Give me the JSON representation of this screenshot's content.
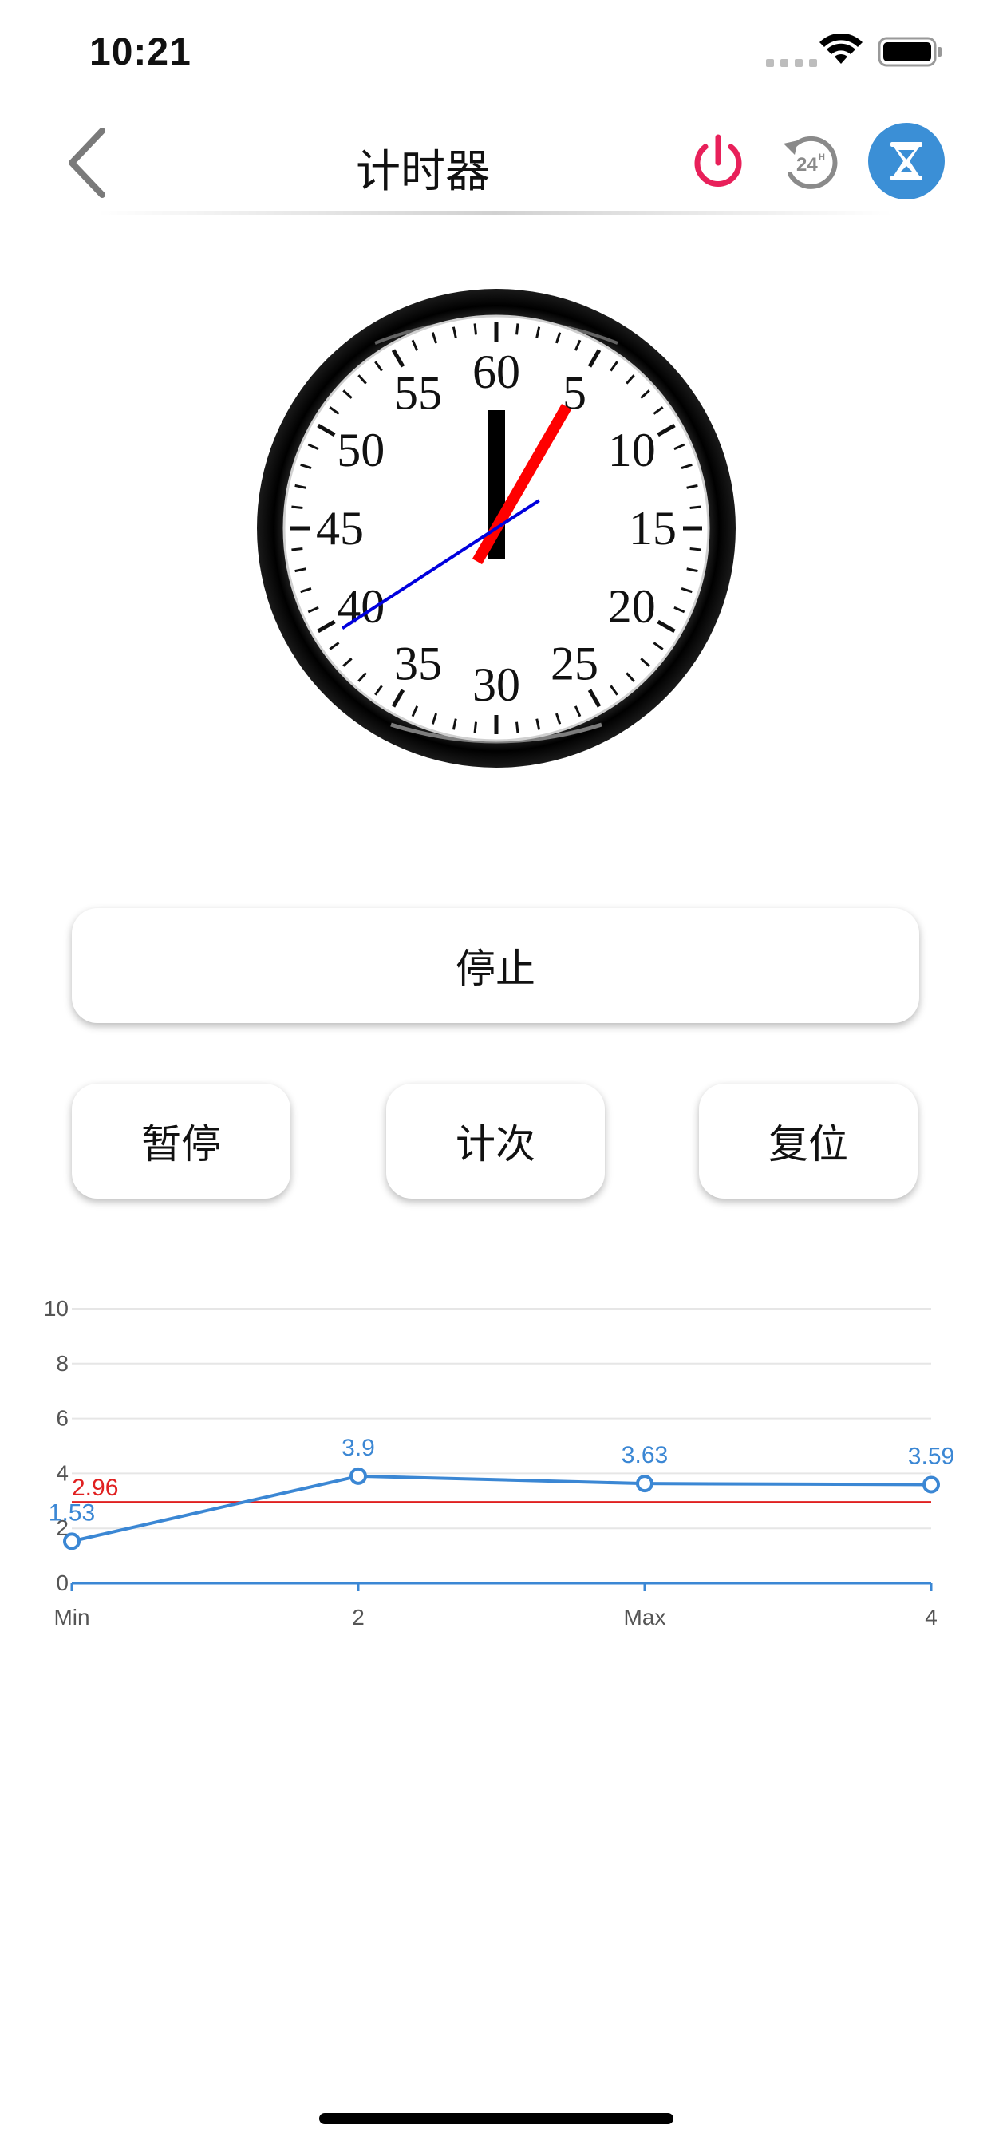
{
  "status_bar": {
    "time": "10:21"
  },
  "nav": {
    "title": "计时器"
  },
  "icons": {
    "back": "chevron-left-icon",
    "power": "power-icon",
    "clock24": "24h-history-icon",
    "timer": "hourglass-icon"
  },
  "colors": {
    "accent": "#3b8fd6",
    "power": "#e8205a",
    "line": "#3b87d4",
    "average": "#e02020"
  },
  "clock": {
    "dial_numbers": [
      "60",
      "5",
      "10",
      "15",
      "20",
      "25",
      "30",
      "35",
      "40",
      "45",
      "50",
      "55"
    ],
    "hands": {
      "minute_hand_value": 0,
      "red_hand_value": 5,
      "blue_hand_value": 9.5
    }
  },
  "buttons": {
    "stop": "停止",
    "pause": "暂停",
    "lap": "计次",
    "reset": "复位"
  },
  "chart_data": {
    "type": "line",
    "categories": [
      "Min",
      "2",
      "Max",
      "4"
    ],
    "values": [
      1.53,
      3.9,
      3.63,
      3.59
    ],
    "data_labels": [
      "1.53",
      "3.9",
      "3.63",
      "3.59"
    ],
    "y_ticks": [
      "0",
      "2",
      "4",
      "6",
      "8",
      "10"
    ],
    "ylim": [
      0,
      10
    ],
    "average": {
      "value": 2.96,
      "label": "2.96"
    },
    "grid": true
  }
}
